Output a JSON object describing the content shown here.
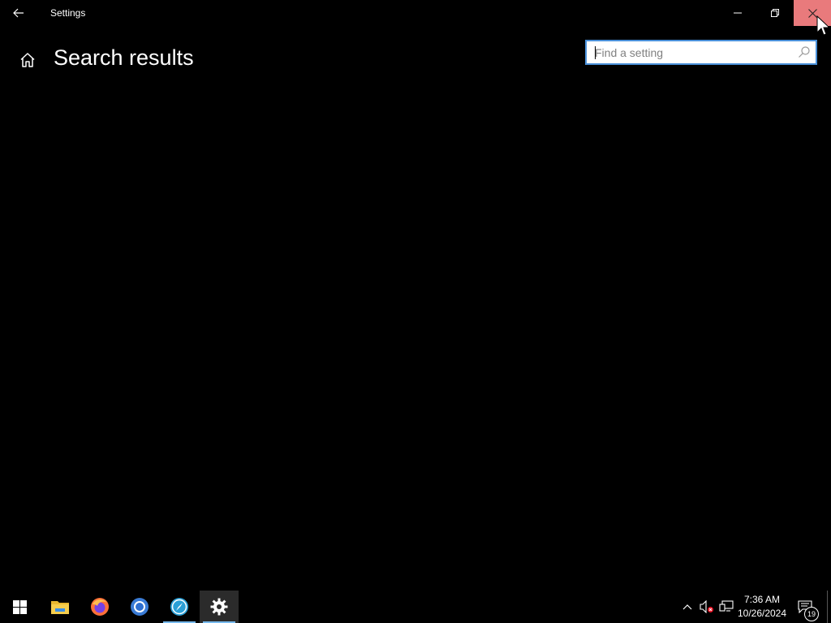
{
  "window": {
    "title": "Settings",
    "page_title": "Search results"
  },
  "search": {
    "placeholder": "Find a setting",
    "value": ""
  },
  "taskbar": {
    "apps": [
      {
        "name": "start",
        "icon": "windows-logo-icon"
      },
      {
        "name": "file-explorer",
        "icon": "folder-icon"
      },
      {
        "name": "firefox",
        "icon": "firefox-icon"
      },
      {
        "name": "chrome",
        "icon": "chrome-icon"
      },
      {
        "name": "app",
        "icon": "compass-app-icon"
      },
      {
        "name": "settings",
        "icon": "gear-icon",
        "active": true
      }
    ],
    "clock_time": "7:36 AM",
    "clock_date": "10/26/2024",
    "notification_count": "19"
  },
  "colors": {
    "background": "#000000",
    "close_hover": "#e97a7c",
    "search_border": "#4a90d9",
    "active_indicator": "#76b9ed"
  }
}
